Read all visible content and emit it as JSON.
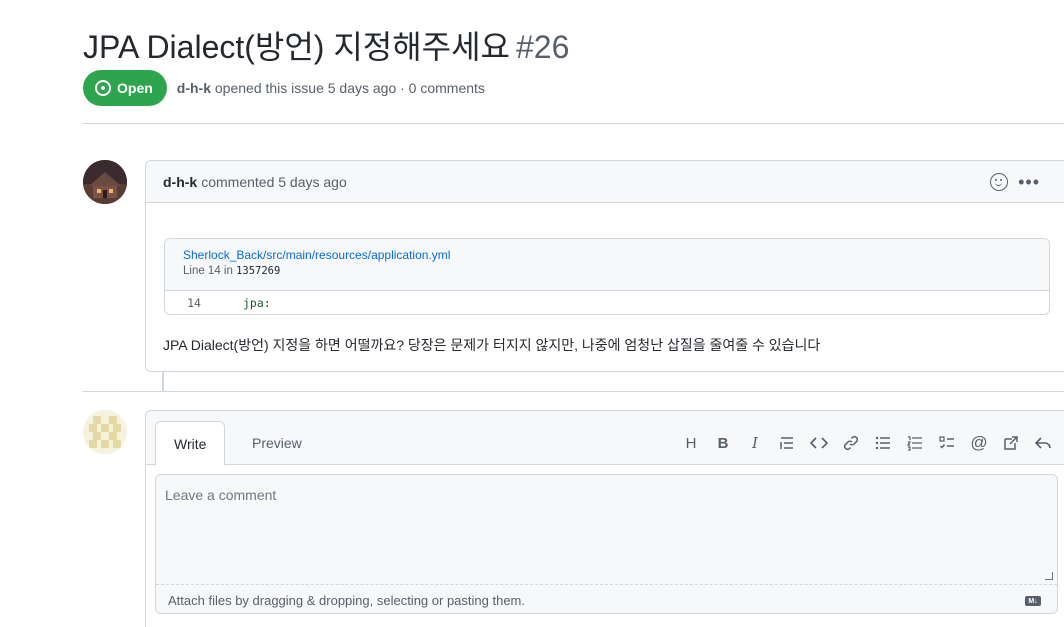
{
  "issue": {
    "title": "JPA Dialect(방언) 지정해주세요",
    "number": "#26",
    "state": "Open",
    "author": "d-h-k",
    "opened_text": "opened this issue 5 days ago · 0 comments"
  },
  "comment": {
    "author": "d-h-k",
    "meta": "commented 5 days ago",
    "snippet": {
      "path": "Sherlock_Back/src/main/resources/application.yml",
      "line_label": "Line 14 in",
      "commit": "1357269",
      "line_number": "14",
      "code": "jpa:"
    },
    "body": "JPA Dialect(방언) 지정을 하면 어떨까요? 당장은 문제가 터지지 않지만, 나중에 엄청난 삽질을 줄여줄 수 있습니다"
  },
  "editor": {
    "tabs": [
      "Write",
      "Preview"
    ],
    "toolbar": [
      "H",
      "B",
      "I",
      "quote",
      "code",
      "link",
      "bulleted-list",
      "numbered-list",
      "task-list",
      "mention",
      "reference",
      "reply"
    ],
    "placeholder": "Leave a comment",
    "attach_hint": "Attach files by dragging & dropping, selecting or pasting them.",
    "markdown_badge": "M↓"
  },
  "colors": {
    "open_green": "#2da44e",
    "link_blue": "#0969da",
    "border": "#d0d7de"
  }
}
